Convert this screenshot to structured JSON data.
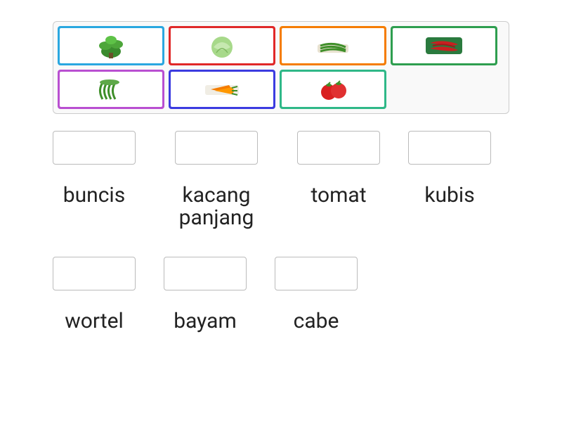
{
  "source_tiles": [
    {
      "id": "bayam",
      "border": "#2aa7e0",
      "veg": "spinach",
      "row1_width": 152
    },
    {
      "id": "kubis",
      "border": "#e02828",
      "veg": "cabbage",
      "row1_width": 152
    },
    {
      "id": "buncis",
      "border": "#f57c00",
      "veg": "green-beans",
      "row1_width": 152
    },
    {
      "id": "cabe",
      "border": "#2e9e4f",
      "veg": "chili",
      "row1_width": 152
    },
    {
      "id": "kacang-panjang",
      "border": "#b94fd1",
      "veg": "long-beans",
      "row2_width": 152
    },
    {
      "id": "wortel",
      "border": "#3b3be0",
      "veg": "carrot",
      "row2_width": 152
    },
    {
      "id": "tomat",
      "border": "#2fb888",
      "veg": "tomato",
      "row2_width": 152
    }
  ],
  "targets": [
    {
      "id": "buncis",
      "label": "buncis"
    },
    {
      "id": "kacang-panjang",
      "label": "kacang\npanjang",
      "wide": true
    },
    {
      "id": "tomat",
      "label": "tomat"
    },
    {
      "id": "kubis",
      "label": "kubis"
    },
    {
      "id": "wortel",
      "label": "wortel"
    },
    {
      "id": "bayam",
      "label": "bayam"
    },
    {
      "id": "cabe",
      "label": "cabe"
    }
  ]
}
